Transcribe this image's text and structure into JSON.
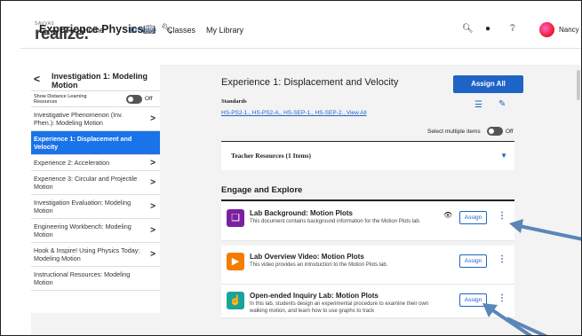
{
  "header": {
    "logo_brand": "SAVVAS",
    "logo_name": "realize.",
    "nav": [
      "Home",
      "Browse",
      "Classes",
      "My Library"
    ],
    "active_nav": "Browse",
    "user_name": "Nancy"
  },
  "course": {
    "title": "Experience Physics"
  },
  "sidebar": {
    "title": "Investigation 1: Modeling Motion",
    "distance_label": "Show Distance Learning Resources",
    "distance_state": "Off",
    "items": [
      {
        "label": "Investigative Phenomenon (Inv. Phen.): Modeling Motion",
        "chevron": true,
        "active": false
      },
      {
        "label": "Experience 1: Displacement and Velocity",
        "chevron": false,
        "active": true
      },
      {
        "label": "Experience 2: Acceleration",
        "chevron": true,
        "active": false
      },
      {
        "label": "Experience 3: Circular and Projectile Motion",
        "chevron": true,
        "active": false
      },
      {
        "label": "Investigation Evaluation: Modeling Motion",
        "chevron": true,
        "active": false
      },
      {
        "label": "Engineering Workbench: Modeling Motion",
        "chevron": true,
        "active": false
      },
      {
        "label": "Hook & Inspire! Using Physics Today: Modeling Motion",
        "chevron": true,
        "active": false
      },
      {
        "label": "Instructional Resources: Modeling Motion",
        "chevron": false,
        "active": false
      }
    ]
  },
  "main": {
    "title": "Experience 1: Displacement and Velocity",
    "assign_all": "Assign All",
    "standards_label": "Standards",
    "standards_links": "HS-PS2-1., HS-PS2-A., HS-SEP-1., HS-SEP-2., View All",
    "select_multiple": "Select multiple items",
    "select_state": "Off",
    "teacher_resources": "Teacher Resources (1 Items)",
    "section_title": "Engage and Explore",
    "cards": [
      {
        "title": "Lab Background: Motion Plots",
        "desc": "This document contains background information for the Motion Plots lab.",
        "assign": "Assign",
        "icon": "document-icon",
        "color": "#7b1fa2"
      },
      {
        "title": "Lab Overview Video: Motion Plots",
        "desc": "This video provides an introduction to the Motion Plots lab.",
        "assign": "Assign",
        "icon": "play-icon",
        "color": "#f57c00"
      },
      {
        "title": "Open-ended Inquiry Lab: Motion Plots",
        "desc": "In this lab, students design an experimental procedure to examine their own walking motion, and learn how to use graphs to track",
        "assign": "Assign",
        "icon": "hand-icon",
        "color": "#1aa39a"
      }
    ]
  },
  "colors": {
    "accent": "#1e63c6",
    "active_item": "#1a73e8",
    "arrow": "#5b86b8"
  }
}
